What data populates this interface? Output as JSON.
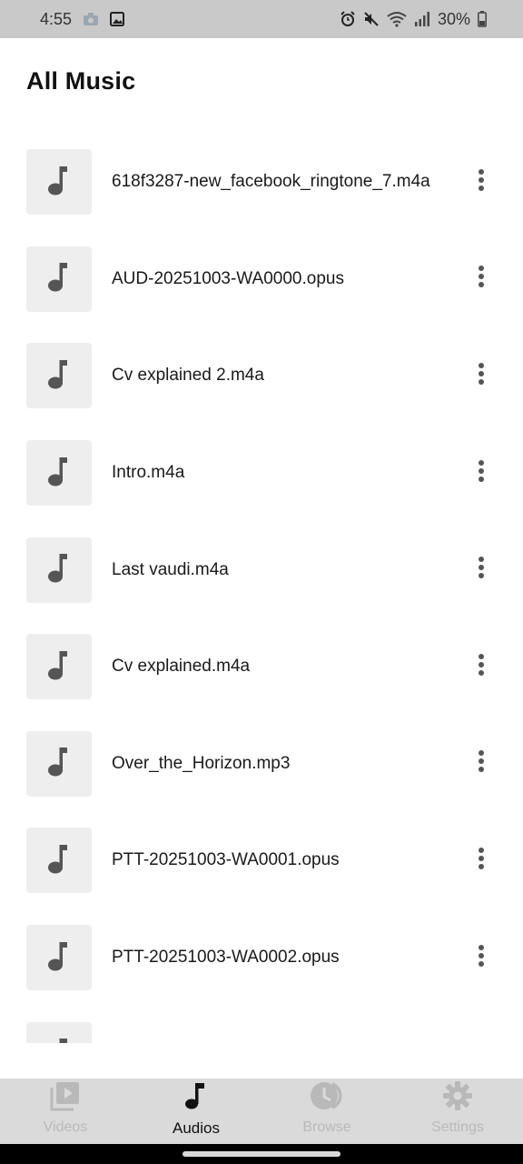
{
  "status_bar": {
    "time": "4:55",
    "battery": "30%",
    "icons_left": [
      "camera-icon",
      "gallery-icon"
    ],
    "icons_right": [
      "alarm-icon",
      "mute-icon",
      "wifi-icon",
      "signal-icon",
      "battery-icon"
    ]
  },
  "header": {
    "title": "All Music"
  },
  "music_list": {
    "items": [
      {
        "title": "618f3287-new_facebook_ringtone_7.m4a"
      },
      {
        "title": "AUD-20251003-WA0000.opus"
      },
      {
        "title": "Cv explained 2.m4a"
      },
      {
        "title": "Intro.m4a"
      },
      {
        "title": "Last vaudi.m4a"
      },
      {
        "title": "Cv explained.m4a"
      },
      {
        "title": "Over_the_Horizon.mp3"
      },
      {
        "title": "PTT-20251003-WA0001.opus"
      },
      {
        "title": "PTT-20251003-WA0002.opus"
      },
      {
        "title": ""
      }
    ]
  },
  "bottom_nav": {
    "active": "Audios",
    "items": [
      {
        "label": "Videos",
        "icon": "video-library-icon"
      },
      {
        "label": "Audios",
        "icon": "music-note-icon"
      },
      {
        "label": "Browse",
        "icon": "history-icon"
      },
      {
        "label": "Settings",
        "icon": "gear-icon"
      }
    ]
  },
  "colors": {
    "status_bar_bg": "#c9c9c9",
    "thumbnail_bg": "#eeeeee",
    "nav_bg": "#dadada",
    "nav_inactive": "#b9b9b9",
    "nav_active": "#111111"
  }
}
